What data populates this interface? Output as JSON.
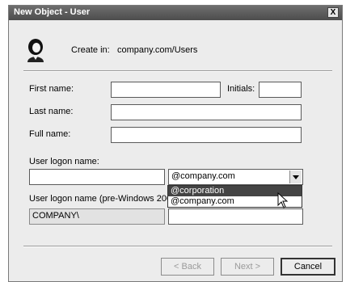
{
  "window": {
    "title": "New Object - User",
    "close_label": "X"
  },
  "header": {
    "create_in_label": "Create in:",
    "create_in_path": "company.com/Users"
  },
  "form": {
    "first_name_label": "First name:",
    "initials_label": "Initials:",
    "last_name_label": "Last name:",
    "full_name_label": "Full name:",
    "logon_name_label": "User logon name:",
    "domain_selected": "@company.com",
    "domain_options": [
      "@corporation",
      "@company.com"
    ],
    "pre2000_label": "User logon name (pre-Windows 2000):",
    "pre2000_domain": "COMPANY\\"
  },
  "buttons": {
    "back": "< Back",
    "next": "Next >",
    "cancel": "Cancel"
  }
}
